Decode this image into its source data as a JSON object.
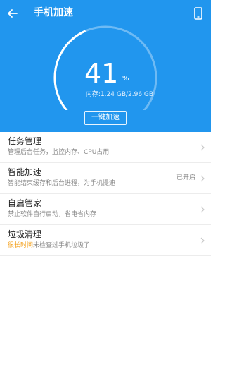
{
  "header": {
    "title": "手机加速",
    "back_icon": "back-arrow-icon",
    "right_icon": "phone-icon"
  },
  "gauge": {
    "percent": "41",
    "percent_unit": "%",
    "fill_fraction": 0.41,
    "memory_text": "内存:1.24 GB/2.96 GB"
  },
  "boost_button": {
    "label": "一键加速"
  },
  "list": {
    "items": [
      {
        "title": "任务管理",
        "subtitle": "管理后台任务，监控内存、CPU占用",
        "status": ""
      },
      {
        "title": "智能加速",
        "subtitle": "智能结束缓存和后台进程，为手机提速",
        "status": "已开启"
      },
      {
        "title": "自启管家",
        "subtitle": "禁止软件自行启动，省电省内存",
        "status": ""
      },
      {
        "title": "垃圾清理",
        "subtitle_highlight": "很长时间",
        "subtitle_rest": "未检查过手机垃圾了",
        "status": ""
      }
    ]
  },
  "colors": {
    "primary": "#2196ee",
    "highlight": "#f39c12"
  }
}
